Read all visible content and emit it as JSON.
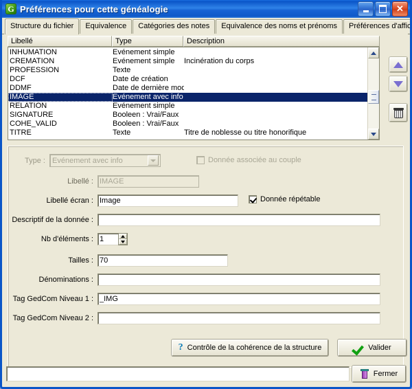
{
  "window": {
    "title": "Préférences pour cette généalogie",
    "icon": "app-logo-icon",
    "minimize_label": "_",
    "maximize_label": "□",
    "close_label": "✕"
  },
  "tabs": [
    {
      "label": "Structure du fichier",
      "active": true
    },
    {
      "label": "Equivalence",
      "active": false
    },
    {
      "label": "Catégories des notes",
      "active": false
    },
    {
      "label": "Equivalence des noms et prénoms",
      "active": false
    },
    {
      "label": "Préférences d'affichage",
      "active": false
    }
  ],
  "list": {
    "columns": [
      "Libellé",
      "Type",
      "Description"
    ],
    "selected_index": 5,
    "rows": [
      {
        "libelle": "INHUMATION",
        "type": "Evénement simple",
        "description": ""
      },
      {
        "libelle": "CREMATION",
        "type": "Evénement simple",
        "description": "Incinération du corps"
      },
      {
        "libelle": "PROFESSION",
        "type": "Texte",
        "description": ""
      },
      {
        "libelle": "DCF",
        "type": "Date de création",
        "description": ""
      },
      {
        "libelle": "DDMF",
        "type": "Date de dernière modification",
        "description": ""
      },
      {
        "libelle": "IMAGE",
        "type": "Evénement avec info",
        "description": ""
      },
      {
        "libelle": "RELATION",
        "type": "Evénement simple",
        "description": ""
      },
      {
        "libelle": "SIGNATURE",
        "type": "Booleen : Vrai/Faux",
        "description": ""
      },
      {
        "libelle": "COHE_VALID",
        "type": "Booleen : Vrai/Faux",
        "description": ""
      },
      {
        "libelle": "TITRE",
        "type": "Texte",
        "description": "Titre de noblesse ou titre honorifique"
      }
    ]
  },
  "side_tools": [
    {
      "name": "move-up",
      "icon": "arrow-up-icon"
    },
    {
      "name": "move-down",
      "icon": "arrow-down-icon"
    },
    {
      "name": "delete",
      "icon": "trash-icon"
    }
  ],
  "form": {
    "type_label": "Type :",
    "type_value": "Evénement avec info",
    "couple_checkbox_label": "Donnée associée au couple",
    "couple_checked": false,
    "libelle_label": "Libellé :",
    "libelle_value": "IMAGE",
    "libelle_ecran_label": "Libellé écran :",
    "libelle_ecran_value": "Image",
    "repeatable_checkbox_label": "Donnée répétable",
    "repeatable_checked": true,
    "descriptif_label": "Descriptif de la donnée :",
    "descriptif_value": "",
    "nb_elements_label": "Nb d'éléments :",
    "nb_elements_value": "1",
    "tailles_label": "Tailles :",
    "tailles_value": "70",
    "denominations_label": "Dénominations :",
    "denominations_value": "",
    "tag1_label": "Tag GedCom Niveau 1 :",
    "tag1_value": "_IMG",
    "tag2_label": "Tag GedCom Niveau 2 :",
    "tag2_value": ""
  },
  "actions": {
    "coherence_label": "Contrôle de la cohérence de la structure",
    "coherence_icon": "question-mark-icon",
    "valider_label": "Valider",
    "valider_icon": "green-check-icon",
    "fermer_label": "Fermer",
    "fermer_icon": "exit-door-icon"
  },
  "status": {
    "text": ""
  },
  "colors": {
    "titlebar": "#0a55c8",
    "panel": "#ece9d8",
    "selection": "#0a246a",
    "accent_green": "#11a011"
  }
}
